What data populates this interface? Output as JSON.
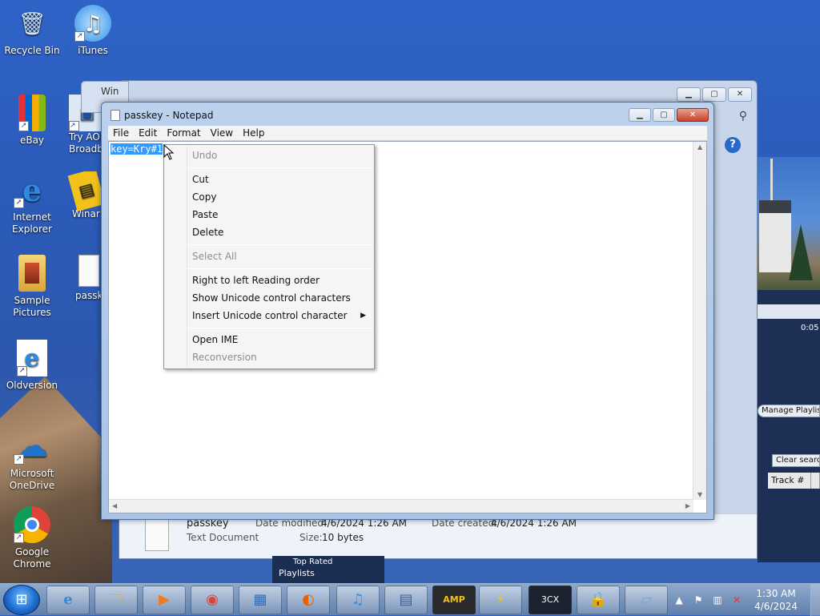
{
  "desktop": {
    "icons": [
      {
        "label": "Recycle Bin",
        "glyph": "🗑"
      },
      {
        "label": "iTunes",
        "glyph": "♫"
      },
      {
        "label": "eBay",
        "glyph": "🛍"
      },
      {
        "label": "Try AOL Broadb",
        "glyph": "▣"
      },
      {
        "label": "Internet Explorer",
        "glyph": "e"
      },
      {
        "label": "Winar",
        "glyph": "▤"
      },
      {
        "label": "Sample Pictures",
        "glyph": "🗀"
      },
      {
        "label": "passk",
        "glyph": "▯"
      },
      {
        "label": "Oldversion",
        "glyph": "e"
      },
      {
        "label": "Microsoft OneDrive",
        "glyph": "☁"
      },
      {
        "label": "Google Chrome",
        "glyph": "◉"
      }
    ]
  },
  "explorer": {
    "file_name": "passkey",
    "file_type": "Text Document",
    "date_modified_label": "Date modified:",
    "date_modified": "4/6/2024 1:26 AM",
    "date_created_label": "Date created:",
    "date_created": "4/6/2024 1:26 AM",
    "size_label": "Size:",
    "size": "10 bytes",
    "help_glyph": "?"
  },
  "back_window": {
    "title": "Win"
  },
  "wmp": {
    "time": "0:05",
    "manage_playlist": "Manage Playlist",
    "clear_search": "Clear search",
    "track_header": "Track #",
    "list_items": [
      "Top Rated",
      "Playlists"
    ]
  },
  "notepad": {
    "title": "passkey - Notepad",
    "menu": [
      "File",
      "Edit",
      "Format",
      "View",
      "Help"
    ],
    "selected_text": "key=Kry#",
    "rest_text": "1"
  },
  "context_menu": {
    "items": [
      {
        "label": "Undo",
        "enabled": false
      },
      {
        "label": "Cut",
        "enabled": true
      },
      {
        "label": "Copy",
        "enabled": true
      },
      {
        "label": "Paste",
        "enabled": true
      },
      {
        "label": "Delete",
        "enabled": true
      },
      {
        "label": "Select All",
        "enabled": false
      },
      {
        "label": "Right to left Reading order",
        "enabled": true
      },
      {
        "label": "Show Unicode control characters",
        "enabled": true
      },
      {
        "label": "Insert Unicode control character",
        "enabled": true,
        "submenu": true
      },
      {
        "label": "Open IME",
        "enabled": true
      },
      {
        "label": "Reconversion",
        "enabled": false
      }
    ]
  },
  "taskbar": {
    "clock_time": "1:30 AM",
    "clock_date": "4/6/2024",
    "buttons": [
      {
        "name": "internet-explorer",
        "glyph": "e"
      },
      {
        "name": "file-explorer",
        "glyph": "🗀"
      },
      {
        "name": "media-player",
        "glyph": "▶"
      },
      {
        "name": "chrome",
        "glyph": "◉"
      },
      {
        "name": "control-panel",
        "glyph": "▦"
      },
      {
        "name": "firefox",
        "glyph": "◐"
      },
      {
        "name": "itunes",
        "glyph": "♫"
      },
      {
        "name": "document-viewer",
        "glyph": "▤"
      },
      {
        "name": "winamp",
        "glyph": "AMP"
      },
      {
        "name": "winamp-bolt",
        "glyph": "⚡"
      },
      {
        "name": "3cx",
        "glyph": "3CX"
      },
      {
        "name": "keepass",
        "glyph": "🔒"
      },
      {
        "name": "notepad",
        "glyph": "▱"
      }
    ]
  }
}
